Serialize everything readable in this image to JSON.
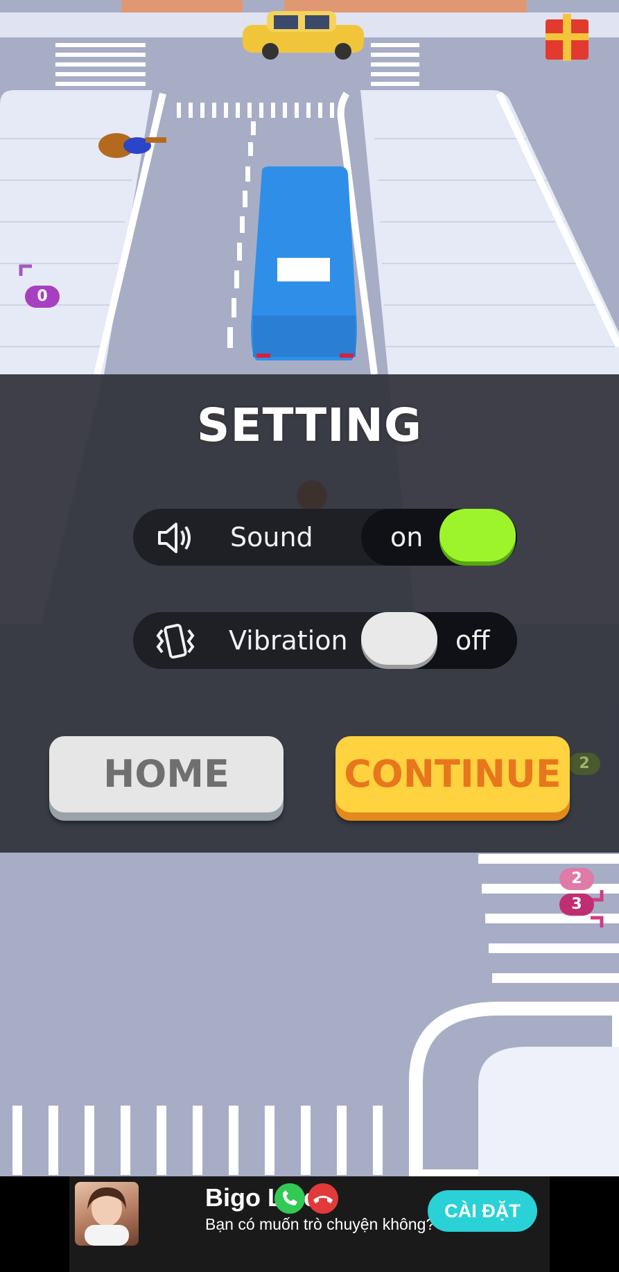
{
  "settings": {
    "title": "SETTING",
    "sound": {
      "label": "Sound",
      "state": "on"
    },
    "vibration": {
      "label": "Vibration",
      "state": "off"
    },
    "home_label": "HOME",
    "continue_label": "CONTINUE"
  },
  "map_badges": {
    "left_player": "0",
    "right_a": "2",
    "right_b": "3",
    "right_c": "2"
  },
  "ad": {
    "title": "Bigo Live",
    "subtitle": "Bạn có muốn trò chuyện không?",
    "install_label": "CÀI ĐẶT"
  },
  "colors": {
    "toggle_on": "#9ef42a",
    "toggle_off": "#e9e9e9",
    "continue_bg": "#ffd23f",
    "continue_text": "#e8761c",
    "home_bg": "#e6e6e6",
    "bus": "#2f8fe8",
    "taxi": "#f0c53a",
    "ad_button": "#2ad1d6"
  },
  "icons": [
    "speaker-icon",
    "vibration-icon",
    "phone-accept-icon",
    "phone-decline-icon",
    "gift-icon"
  ]
}
